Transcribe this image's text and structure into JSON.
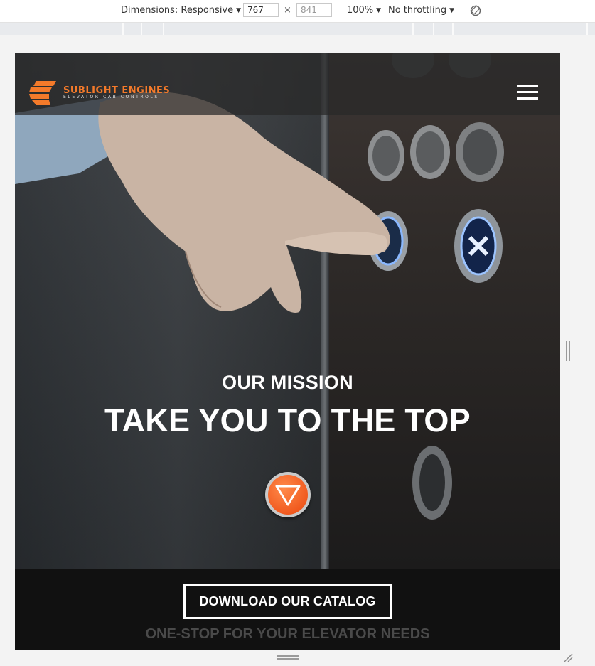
{
  "devtools": {
    "dimensions_label": "Dimensions: Responsive",
    "width_value": "767",
    "times": "×",
    "height_value": "841",
    "zoom": "100%",
    "throttling": "No throttling",
    "caret": "▼"
  },
  "site": {
    "logo": {
      "title": "SUBLIGHT ENGINES",
      "subtitle": "ELEVATOR CAB CONTROLS",
      "accent_color": "#f47a2a"
    },
    "menu_icon": "hamburger-icon",
    "hero": {
      "eyebrow": "OUR MISSION",
      "headline": "TAKE YOU TO THE TOP",
      "scroll_icon": "triangle-down-icon",
      "accent_color": "#f15a1f"
    },
    "cta": {
      "button_label": "DOWNLOAD OUR CATALOG",
      "tagline": "ONE-STOP FOR YOUR ELEVATOR NEEDS"
    }
  }
}
